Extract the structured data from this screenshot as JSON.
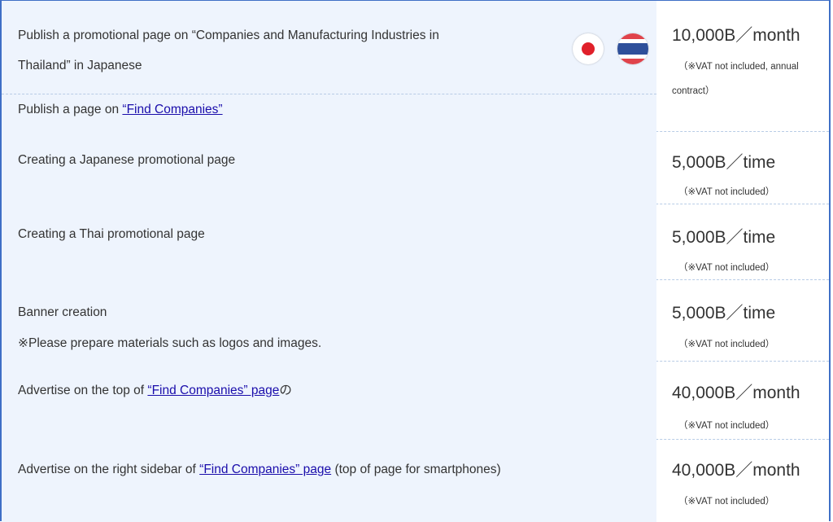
{
  "rows": [
    {
      "line1": "Publish a promotional page on “Companies and Manufacturing Industries in",
      "line2": "Thailand” in Japanese",
      "sub_prefix": "Publish a page on ",
      "sub_link": "“Find Companies”",
      "price": "10,000B／month",
      "note": "（※VAT not included, annual contract）"
    },
    {
      "text": "Creating a Japanese promotional page",
      "price": "5,000B／time",
      "note": "（※VAT not included）"
    },
    {
      "text": "Creating a Thai promotional page",
      "price": "5,000B／time",
      "note": "（※VAT not included）"
    },
    {
      "text": "Banner creation",
      "text2": "※Please prepare materials such as logos and images.",
      "price": "5,000B／time",
      "note": "（※VAT not included）"
    },
    {
      "prefix": "Advertise on the top of ",
      "link": "“Find Companies” page",
      "suffix": "の",
      "price": "40,000B／month",
      "note": "（※VAT not included）"
    },
    {
      "prefix": "Advertise on the right sidebar of ",
      "link": "“Find Companies” page",
      "suffix": " (top of page for smartphones)",
      "price": "40,000B／month",
      "note": "（※VAT not included）"
    }
  ],
  "icons": {
    "flag_japan": "japan-flag-icon",
    "flag_thailand": "thailand-flag-icon"
  },
  "colors": {
    "border": "#3f6fc6",
    "left_bg": "#eef4fd",
    "link": "#1a0dab",
    "dash": "#b8cce6"
  }
}
